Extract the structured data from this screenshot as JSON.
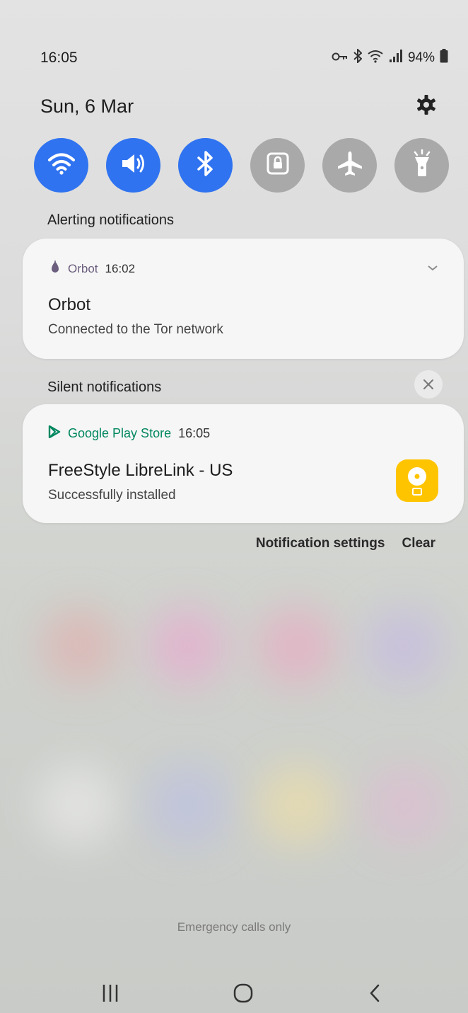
{
  "status_bar": {
    "time": "16:05",
    "battery_percent": "94%",
    "icons": [
      "vpn-key-icon",
      "bluetooth-icon",
      "wifi-icon",
      "signal-icon",
      "battery-icon"
    ]
  },
  "header": {
    "date": "Sun, 6 Mar",
    "settings_icon": "gear-icon"
  },
  "quick_toggles": [
    {
      "name": "wifi",
      "icon": "wifi-icon",
      "state": "on"
    },
    {
      "name": "sound",
      "icon": "volume-icon",
      "state": "on"
    },
    {
      "name": "bluetooth",
      "icon": "bluetooth-icon",
      "state": "on"
    },
    {
      "name": "rotation-lock",
      "icon": "lock-icon",
      "state": "off"
    },
    {
      "name": "airplane-mode",
      "icon": "airplane-icon",
      "state": "off"
    },
    {
      "name": "flashlight",
      "icon": "flashlight-icon",
      "state": "off"
    }
  ],
  "alerting": {
    "section_label": "Alerting notifications",
    "notification": {
      "app": "Orbot",
      "time": "16:02",
      "title": "Orbot",
      "text": "Connected to the Tor network"
    }
  },
  "silent": {
    "section_label": "Silent notifications",
    "notification": {
      "app": "Google Play Store",
      "time": "16:05",
      "title": "FreeStyle LibreLink - US",
      "text": "Successfully installed"
    }
  },
  "actions": {
    "settings_label": "Notification settings",
    "clear_label": "Clear"
  },
  "footer": {
    "emergency_text": "Emergency calls only"
  },
  "colors": {
    "toggle_on": "#2f73f0",
    "toggle_off": "#a9a9a9",
    "play_store_green": "#01875f",
    "librelink_yellow": "#ffc400"
  }
}
